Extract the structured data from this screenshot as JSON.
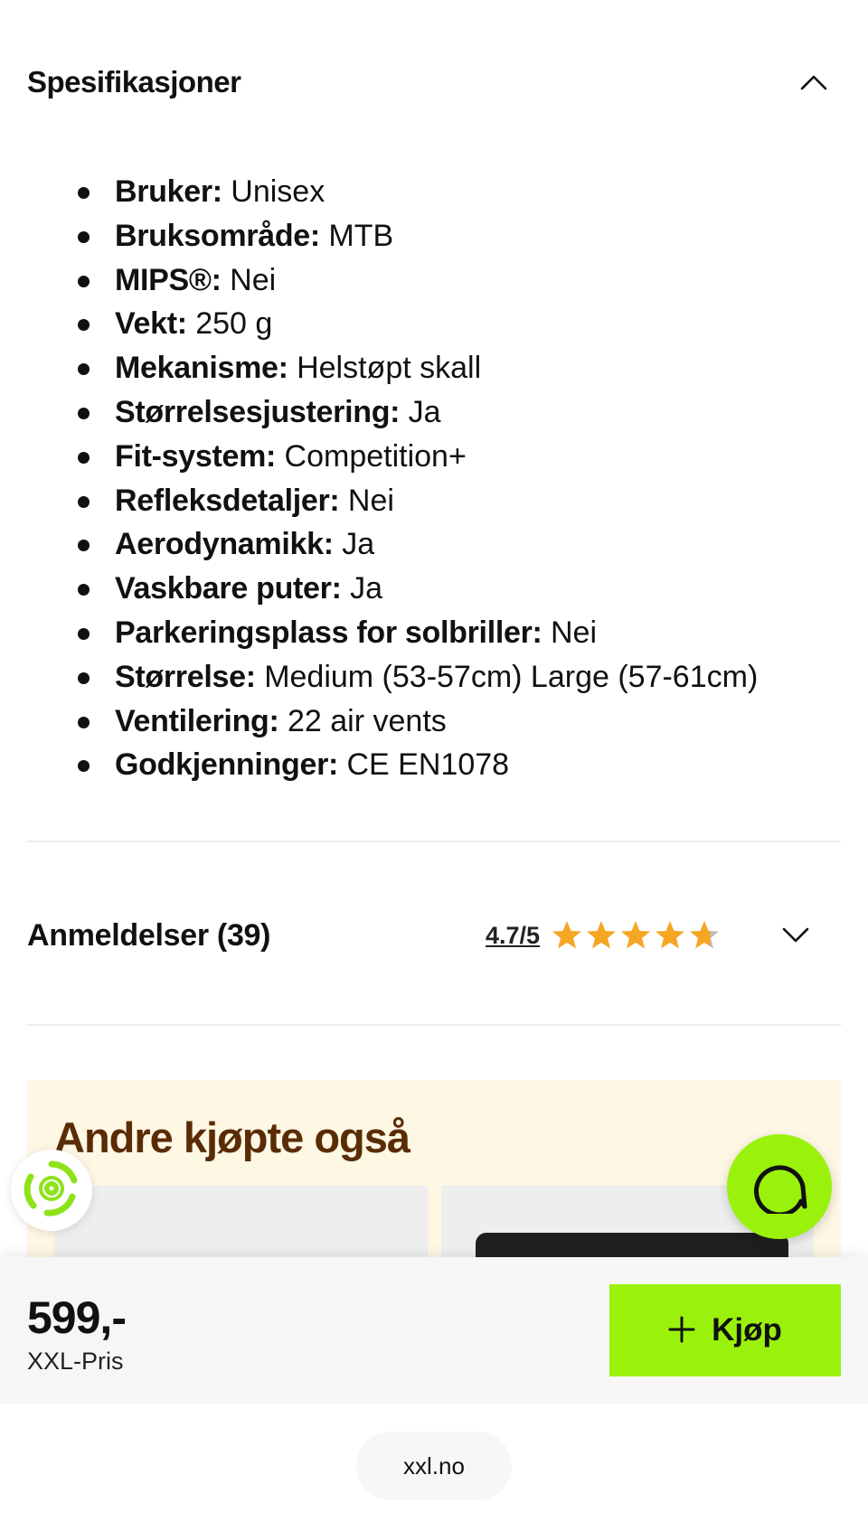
{
  "specifications": {
    "title": "Spesifikasjoner",
    "expanded_icon": "chevron-up-icon",
    "items": [
      {
        "label": "Bruker:",
        "value": "Unisex"
      },
      {
        "label": "Bruksområde:",
        "value": "MTB"
      },
      {
        "label": "MIPS®:",
        "value": "Nei"
      },
      {
        "label": "Vekt:",
        "value": "250 g"
      },
      {
        "label": "Mekanisme:",
        "value": "Helstøpt skall"
      },
      {
        "label": "Størrelsesjustering:",
        "value": "Ja"
      },
      {
        "label": "Fit-system:",
        "value": "Competition+"
      },
      {
        "label": "Refleksdetaljer:",
        "value": "Nei"
      },
      {
        "label": "Aerodynamikk:",
        "value": "Ja"
      },
      {
        "label": "Vaskbare puter:",
        "value": "Ja"
      },
      {
        "label": "Parkeringsplass for solbriller:",
        "value": "Nei"
      },
      {
        "label": "Størrelse:",
        "value": "Medium (53-57cm) Large (57-61cm)"
      },
      {
        "label": "Ventilering:",
        "value": "22 air vents"
      },
      {
        "label": "Godkjenninger:",
        "value": "CE EN1078"
      }
    ]
  },
  "reviews": {
    "title": "Anmeldelser (39)",
    "score": "4.7/5",
    "rating_value": 4.7,
    "rating_max": 5,
    "star_color": "#f5a623",
    "collapsed_icon": "chevron-down-icon"
  },
  "promo": {
    "title": "Andre kjøpte også",
    "background": "#fdf7e4",
    "title_color": "#5a2c06"
  },
  "buy_bar": {
    "price": "599,-",
    "price_label": "XXL-Pris",
    "buy_label": "Kjøp",
    "buy_icon": "plus-icon",
    "accent": "#9af20c"
  },
  "floating": {
    "recycle_icon": "recycle-icon",
    "chat_icon": "chat-icon"
  },
  "browser": {
    "url": "xxl.no"
  }
}
